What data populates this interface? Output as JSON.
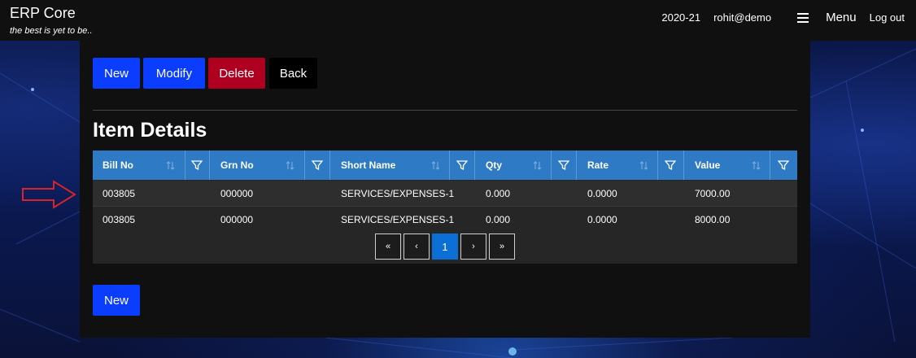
{
  "header": {
    "app_title": "ERP Core",
    "tagline": "the best is yet to be..",
    "year": "2020-21",
    "user": "rohit@demo",
    "menu_label": "Menu",
    "logout_label": "Log out"
  },
  "toolbar": {
    "new_label": "New",
    "modify_label": "Modify",
    "delete_label": "Delete",
    "back_label": "Back"
  },
  "section": {
    "title": "Item Details"
  },
  "table": {
    "columns": [
      "Bill No",
      "Grn No",
      "Short Name",
      "Qty",
      "Rate",
      "Value"
    ],
    "rows": [
      [
        "003805",
        "000000",
        "SERVICES/EXPENSES-1",
        "0.000",
        "0.0000",
        "7000.00"
      ],
      [
        "003805",
        "000000",
        "SERVICES/EXPENSES-1",
        "0.000",
        "0.0000",
        "8000.00"
      ]
    ]
  },
  "pager": {
    "first": "«",
    "prev": "‹",
    "current": "1",
    "next": "›",
    "last": "»"
  },
  "footer": {
    "new_label": "New"
  },
  "icons": {
    "menu": "hamburger-icon",
    "sort": "sort-icon",
    "filter": "filter-icon",
    "pointer": "arrow-right-icon"
  },
  "colors": {
    "primary_button": "#0a3dff",
    "danger_button": "#b00020",
    "grid_header": "#2f7ac4",
    "active_page": "#0b6fd6",
    "pointer_arrow": "#d8232a"
  }
}
